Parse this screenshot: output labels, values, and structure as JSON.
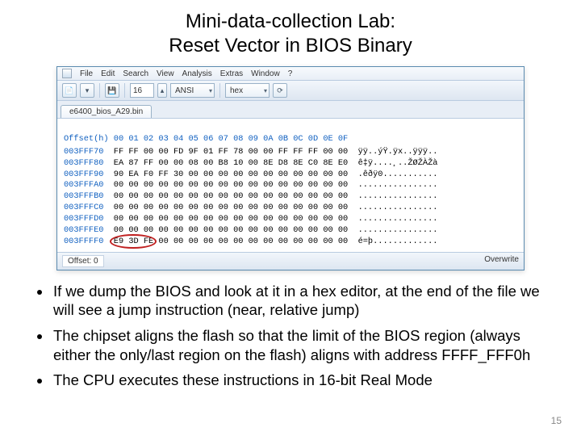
{
  "title_line1": "Mini-data-collection Lab:",
  "title_line2": "Reset Vector in BIOS Binary",
  "menu": [
    "File",
    "Edit",
    "Search",
    "View",
    "Analysis",
    "Extras",
    "Window",
    "?"
  ],
  "toolbar": {
    "width_value": "16",
    "charset": "ANSI",
    "mode": "hex"
  },
  "tab_label": "e6400_bios_A29.bin",
  "hex_header": "Offset(h) 00 01 02 03 04 05 06 07 08 09 0A 0B 0C 0D 0E 0F",
  "rows": [
    {
      "addr": "003FFF70",
      "bytes": "FF FF 00 00 FD 9F 01 FF 78 00 00 FF FF FF 00 00",
      "ascii": "ÿÿ..ýŸ.ÿx..ÿÿÿ.."
    },
    {
      "addr": "003FFF80",
      "bytes": "EA 87 FF 00 00 08 00 B8 10 00 8E D8 8E C0 8E E0",
      "ascii": "ê‡ÿ....¸..ŽØŽÀŽà"
    },
    {
      "addr": "003FFF90",
      "bytes": "90 EA F0 FF 30 00 00 00 00 00 00 00 00 00 00 00",
      "ascii": ".êðÿ0..........."
    },
    {
      "addr": "003FFFA0",
      "bytes": "00 00 00 00 00 00 00 00 00 00 00 00 00 00 00 00",
      "ascii": "................"
    },
    {
      "addr": "003FFFB0",
      "bytes": "00 00 00 00 00 00 00 00 00 00 00 00 00 00 00 00",
      "ascii": "................"
    },
    {
      "addr": "003FFFC0",
      "bytes": "00 00 00 00 00 00 00 00 00 00 00 00 00 00 00 00",
      "ascii": "................"
    },
    {
      "addr": "003FFFD0",
      "bytes": "00 00 00 00 00 00 00 00 00 00 00 00 00 00 00 00",
      "ascii": "................"
    },
    {
      "addr": "003FFFE0",
      "bytes": "00 00 00 00 00 00 00 00 00 00 00 00 00 00 00 00",
      "ascii": "................"
    },
    {
      "addr": "003FFFF0",
      "bytes": "E9 3D FE 00 00 00 00 00 00 00 00 00 00 00 00 00",
      "ascii": "é=þ............."
    }
  ],
  "status_left": "Offset: 0",
  "status_right": "Overwrite",
  "bullets": [
    "If we dump the BIOS and look at it in a hex editor, at the end of the file we will see a jump instruction (near, relative jump)",
    "The chipset aligns the flash so that the limit of the BIOS region (always either the only/last region on the flash) aligns with address FFFF_FFF0h",
    "The CPU executes these instructions in 16-bit Real Mode"
  ],
  "page_number": "15"
}
